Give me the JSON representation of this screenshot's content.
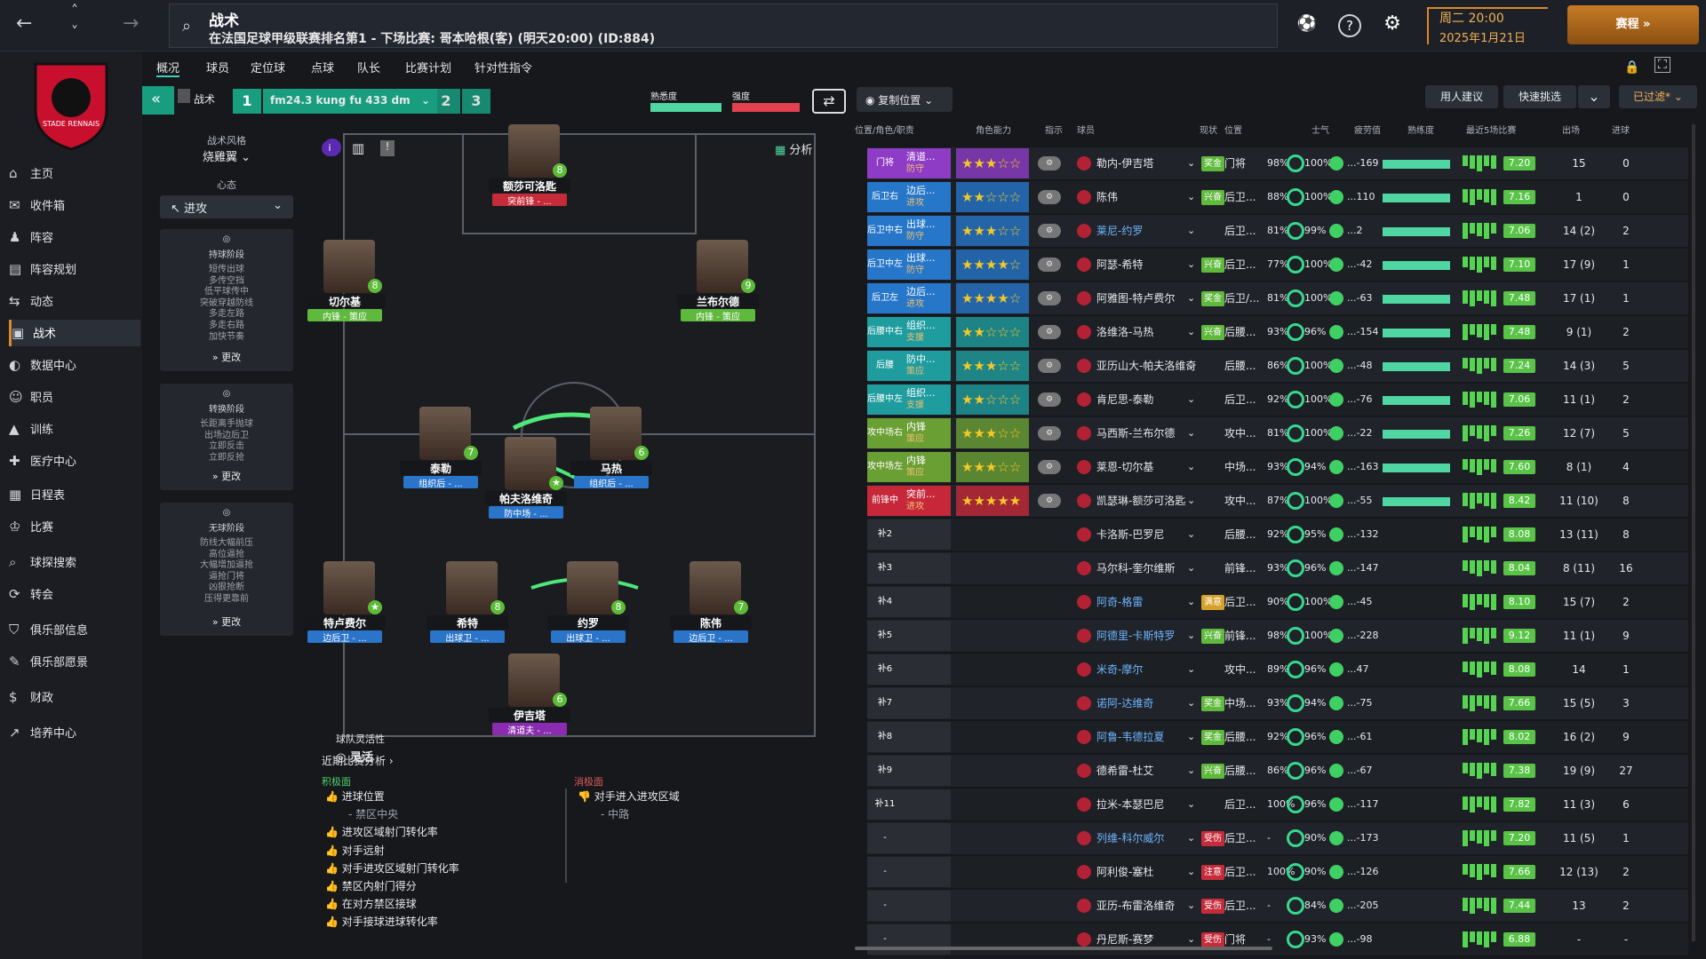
{
  "header": {
    "title": "战术",
    "subtitle": "在法国足球甲级联赛排名第1 - 下场比赛: 哥本哈根(客) (明天20:00) (ID:884)",
    "date_line1": "周二 20:00",
    "date_line2": "2025年1月21日",
    "continue_label": "赛程 »"
  },
  "sidebar": {
    "items": [
      {
        "label": "主页",
        "icon": "home-icon"
      },
      {
        "label": "收件箱",
        "icon": "inbox-icon"
      },
      {
        "label": "阵容",
        "icon": "squad-icon"
      },
      {
        "label": "阵容规划",
        "icon": "planner-icon"
      },
      {
        "label": "动态",
        "icon": "dynamics-icon"
      },
      {
        "label": "战术",
        "icon": "tactics-icon"
      },
      {
        "label": "数据中心",
        "icon": "data-icon"
      },
      {
        "label": "职员",
        "icon": "staff-icon"
      },
      {
        "label": "训练",
        "icon": "training-icon"
      },
      {
        "label": "医疗中心",
        "icon": "medical-icon"
      },
      {
        "label": "日程表",
        "icon": "calendar-icon"
      },
      {
        "label": "比赛",
        "icon": "trophy-icon"
      },
      {
        "label": "球探搜索",
        "icon": "scout-icon"
      },
      {
        "label": "转会",
        "icon": "transfer-icon"
      },
      {
        "label": "俱乐部信息",
        "icon": "club-icon"
      },
      {
        "label": "俱乐部愿景",
        "icon": "vision-icon"
      },
      {
        "label": "财政",
        "icon": "finance-icon"
      },
      {
        "label": "培养中心",
        "icon": "development-icon"
      }
    ]
  },
  "tabs": [
    "概况",
    "球员",
    "定位球",
    "点球",
    "队长",
    "比赛计划",
    "针对性指令"
  ],
  "tactic": {
    "label": "战术",
    "name": "fm24.3 kung fu 433 dm",
    "slot1": "1",
    "slot2": "2",
    "slot3": "3",
    "fam_label": "熟悉度",
    "intensity_label": "强度",
    "copy_label": "复制位置",
    "analysis_label": "分析"
  },
  "left": {
    "style_title": "战术风格",
    "style_value": "烧雞翼",
    "mentality_title": "心态",
    "mentality_value": "进攻",
    "in_poss_title": "持球阶段",
    "in_poss": [
      "短传出球",
      "多传空挡",
      "低平球传中",
      "突破穿越防线",
      "多走左路",
      "多走右路",
      "加快节奏"
    ],
    "trans_title": "转换阶段",
    "trans": [
      "长距离手抛球",
      "出场边后卫",
      "立即反击",
      "立即反抢"
    ],
    "oop_title": "无球阶段",
    "oop": [
      "防线大幅前压",
      "高位逼抢",
      "大幅增加逼抢",
      "逼抢门将",
      "凶狠抢断",
      "压得更靠前"
    ],
    "more": "更改",
    "flex_title": "球队灵活性",
    "flex_value": "灵活"
  },
  "pitch_players": [
    {
      "name": "额莎可洛匙",
      "role": "突前锋 - ...",
      "num": "8"
    },
    {
      "name": "切尔基",
      "role": "内锋 - 策应",
      "num": "8"
    },
    {
      "name": "兰布尔德",
      "role": "内锋 - 策应",
      "num": "9"
    },
    {
      "name": "泰勒",
      "role": "组织后 - ...",
      "num": "7"
    },
    {
      "name": "帕夫洛维奇",
      "role": "防中场 - ...",
      "num": "★"
    },
    {
      "name": "马热",
      "role": "组织后 - ...",
      "num": "6"
    },
    {
      "name": "特卢费尔",
      "role": "边后卫 - ...",
      "num": "★"
    },
    {
      "name": "希特",
      "role": "出球卫 - ...",
      "num": "8"
    },
    {
      "name": "约罗",
      "role": "出球卫 - ...",
      "num": "8"
    },
    {
      "name": "陈伟",
      "role": "边后卫 - ...",
      "num": "7"
    },
    {
      "name": "伊吉塔",
      "role": "清道夫 - ...",
      "num": "6"
    }
  ],
  "analysis": {
    "title": "近期比赛分析 ›",
    "pos_title": "积极面",
    "neg_title": "消极面",
    "pos": [
      "进球位置",
      "- 禁区中央",
      "进攻区域射门转化率",
      "对手远射",
      "对手进攻区域射门转化率",
      "禁区内射门得分",
      "在对方禁区接球",
      "对手接球进球转化率"
    ],
    "neg": [
      "对手进入进攻区域",
      "- 中路"
    ]
  },
  "top_right": {
    "recommend": "用人建议",
    "quick": "快速挑选",
    "filtered": "已过滤*"
  },
  "table": {
    "headers": [
      "位置/角色/职责",
      "角色能力",
      "指示",
      "球员",
      "现状",
      "位置",
      "士气",
      "疲劳值",
      "熟练度",
      "最近5场比赛",
      "出场",
      "进球"
    ],
    "rows": [
      {
        "pos": "门将",
        "role": "清道...",
        "duty": "防守",
        "stars": 3,
        "player": "勒内-伊吉塔",
        "status": "奖金",
        "position": "门将",
        "fam": "98%",
        "cond": "100%",
        "last": "...-169",
        "rating": "7.20",
        "apps": "15",
        "goals": "0"
      },
      {
        "pos": "后卫右",
        "role": "边后...",
        "duty": "进攻",
        "stars": 2,
        "player": "陈伟",
        "status": "兴奋",
        "position": "后卫...",
        "fam": "88%",
        "cond": "100%",
        "last": "...110",
        "rating": "7.16",
        "apps": "1",
        "goals": "0"
      },
      {
        "pos": "后卫中右",
        "role": "出球...",
        "duty": "防守",
        "stars": 2.5,
        "player": "莱尼-约罗",
        "status": "",
        "position": "后卫...",
        "fam": "81%",
        "cond": "99%",
        "last": "...2",
        "rating": "7.06",
        "apps": "14 (2)",
        "goals": "2"
      },
      {
        "pos": "后卫中左",
        "role": "出球...",
        "duty": "防守",
        "stars": 3.5,
        "player": "阿瑟-希特",
        "status": "兴奋",
        "position": "后卫...",
        "fam": "77%",
        "cond": "100%",
        "last": "...-42",
        "rating": "7.10",
        "apps": "17 (9)",
        "goals": "1"
      },
      {
        "pos": "后卫左",
        "role": "边后...",
        "duty": "进攻",
        "stars": 4,
        "player": "阿雅图-特卢费尔",
        "status": "奖金",
        "position": "后卫/...",
        "fam": "81%",
        "cond": "100%",
        "last": "...-63",
        "rating": "7.48",
        "apps": "17 (1)",
        "goals": "1"
      },
      {
        "pos": "后腰中右",
        "role": "组织...",
        "duty": "支援",
        "stars": 2,
        "player": "洛维洛-马热",
        "status": "兴奋",
        "position": "后腰...",
        "fam": "93%",
        "cond": "96%",
        "last": "...-154",
        "rating": "7.48",
        "apps": "9 (1)",
        "goals": "2"
      },
      {
        "pos": "后腰",
        "role": "防中...",
        "duty": "策应",
        "stars": 3,
        "player": "亚历山大-帕夫洛维奇",
        "status": "",
        "position": "后腰...",
        "fam": "86%",
        "cond": "100%",
        "last": "...-48",
        "rating": "7.24",
        "apps": "14 (3)",
        "goals": "5"
      },
      {
        "pos": "后腰中左",
        "role": "组织...",
        "duty": "支援",
        "stars": 2,
        "player": "肯尼思-泰勒",
        "status": "",
        "position": "后卫...",
        "fam": "92%",
        "cond": "100%",
        "last": "...-76",
        "rating": "7.06",
        "apps": "11 (1)",
        "goals": "2"
      },
      {
        "pos": "攻中场右",
        "role": "内锋",
        "duty": "策应",
        "stars": 3,
        "player": "马西斯-兰布尔德",
        "status": "",
        "position": "攻中...",
        "fam": "81%",
        "cond": "100%",
        "last": "...-22",
        "rating": "7.26",
        "apps": "12 (7)",
        "goals": "5"
      },
      {
        "pos": "攻中场左",
        "role": "内锋",
        "duty": "策应",
        "stars": 2.5,
        "player": "莱恩-切尔基",
        "status": "",
        "position": "中场...",
        "fam": "93%",
        "cond": "94%",
        "last": "...-163",
        "rating": "7.60",
        "apps": "8 (1)",
        "goals": "4"
      },
      {
        "pos": "前锋中",
        "role": "突前...",
        "duty": "进攻",
        "stars": 4.5,
        "player": "凯瑟琳-额莎可洛匙",
        "status": "",
        "position": "攻中...",
        "fam": "87%",
        "cond": "100%",
        "last": "...-55",
        "rating": "8.42",
        "apps": "11 (10)",
        "goals": "8"
      },
      {
        "pos": "补2",
        "player": "卡洛斯-巴罗尼",
        "position": "后腰...",
        "fam": "92%",
        "cond": "95%",
        "last": "...-132",
        "rating": "8.08",
        "apps": "13 (11)",
        "goals": "8"
      },
      {
        "pos": "补3",
        "player": "马尔科-奎尔维斯",
        "position": "前锋...",
        "fam": "93%",
        "cond": "96%",
        "last": "...-147",
        "rating": "8.04",
        "apps": "8 (11)",
        "goals": "16"
      },
      {
        "pos": "补4",
        "player": "阿奇-格雷",
        "status": "满意",
        "position": "后卫...",
        "fam": "90%",
        "cond": "100%",
        "last": "...-45",
        "rating": "8.10",
        "apps": "15 (7)",
        "goals": "2"
      },
      {
        "pos": "补5",
        "player": "阿德里-卡斯特罗",
        "status": "兴奋",
        "position": "前锋...",
        "fam": "98%",
        "cond": "100%",
        "last": "...-228",
        "rating": "9.12",
        "apps": "11 (1)",
        "goals": "9"
      },
      {
        "pos": "补6",
        "player": "米奇-摩尔",
        "position": "攻中...",
        "fam": "89%",
        "cond": "96%",
        "last": "...47",
        "rating": "8.08",
        "apps": "14",
        "goals": "1"
      },
      {
        "pos": "补7",
        "player": "诺阿-达维奇",
        "status": "奖金",
        "position": "中场...",
        "fam": "93%",
        "cond": "94%",
        "last": "...-75",
        "rating": "7.66",
        "apps": "15 (5)",
        "goals": "3"
      },
      {
        "pos": "补8",
        "player": "阿鲁-韦德拉夏",
        "status": "奖金",
        "position": "后腰...",
        "fam": "92%",
        "cond": "96%",
        "last": "...-61",
        "rating": "8.02",
        "apps": "16 (2)",
        "goals": "9"
      },
      {
        "pos": "补9",
        "player": "德希雷-杜艾",
        "status": "兴奋",
        "position": "后腰...",
        "fam": "86%",
        "cond": "96%",
        "last": "...-67",
        "rating": "7.38",
        "apps": "19 (9)",
        "goals": "27"
      },
      {
        "pos": "补11",
        "player": "拉米-本瑟巴尼",
        "position": "后卫...",
        "fam": "100%",
        "cond": "96%",
        "last": "...-117",
        "rating": "7.82",
        "apps": "11 (3)",
        "goals": "6"
      },
      {
        "pos": "-",
        "player": "列维-科尔威尔",
        "status": "受伤",
        "position": "后卫...",
        "fam": "-",
        "cond": "90%",
        "last": "...-173",
        "rating": "7.20",
        "apps": "11 (5)",
        "goals": "1"
      },
      {
        "pos": "-",
        "player": "阿利俊-塞杜",
        "status": "注意",
        "position": "后卫...",
        "fam": "100%",
        "cond": "90%",
        "last": "...-126",
        "rating": "7.66",
        "apps": "12 (13)",
        "goals": "2"
      },
      {
        "pos": "-",
        "player": "亚历-布雷洛维奇",
        "status": "受伤",
        "position": "后卫...",
        "fam": "-",
        "cond": "84%",
        "last": "...-205",
        "rating": "7.44",
        "apps": "13",
        "goals": "2"
      },
      {
        "pos": "-",
        "player": "丹尼斯-赛梦",
        "status": "受伤",
        "position": "门将",
        "fam": "-",
        "cond": "93%",
        "last": "...-98",
        "rating": "6.88",
        "apps": "-",
        "goals": "-"
      }
    ]
  }
}
